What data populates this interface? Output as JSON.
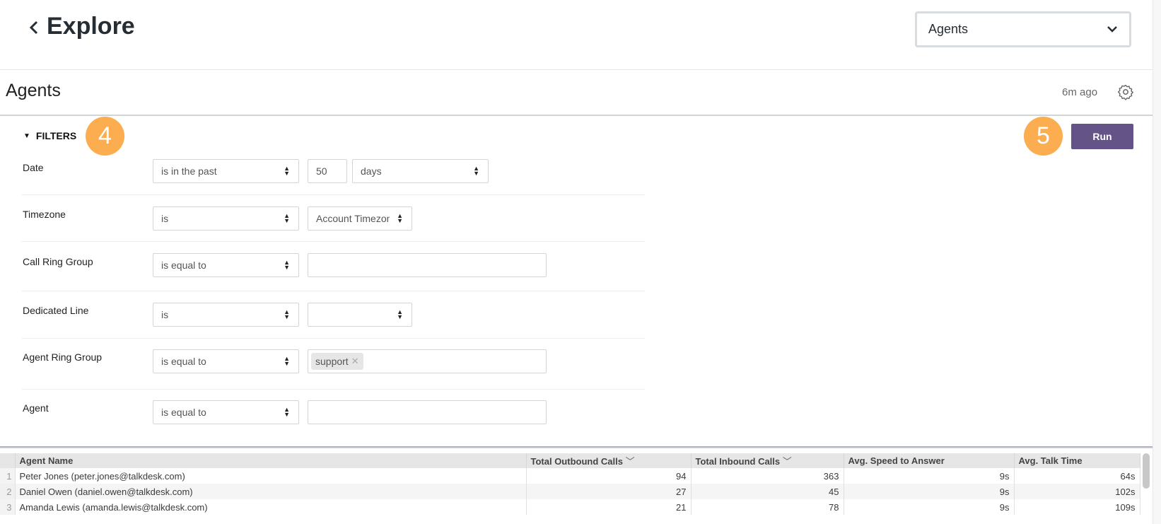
{
  "header": {
    "title": "Explore",
    "back_icon": "chevron-left-icon",
    "explore_select": "Agents"
  },
  "title_bar": {
    "title": "Agents",
    "updated": "6m ago",
    "settings_icon": "gear-icon"
  },
  "filters": {
    "toggle_label": "FILTERS",
    "run_label": "Run",
    "run_color": "#645386",
    "rows": [
      {
        "label": "Date",
        "operator": "is in the past",
        "value": "50",
        "unit": "days"
      },
      {
        "label": "Timezone",
        "operator": "is",
        "value": "Account Timezone"
      },
      {
        "label": "Call Ring Group",
        "operator": "is equal to",
        "value": ""
      },
      {
        "label": "Dedicated Line",
        "operator": "is",
        "value": ""
      },
      {
        "label": "Agent Ring Group",
        "operator": "is equal to",
        "chips": [
          "support"
        ]
      },
      {
        "label": "Agent",
        "operator": "is equal to",
        "value": ""
      }
    ]
  },
  "annotations": {
    "badge_filters": "4",
    "badge_run": "5",
    "badge_color": "#fbad50"
  },
  "table": {
    "columns": [
      "Agent Name",
      "Total Outbound Calls",
      "Total Inbound Calls",
      "Avg. Speed to Answer",
      "Avg. Talk Time"
    ],
    "rows": [
      {
        "n": "1",
        "name": "Peter Jones (peter.jones@talkdesk.com)",
        "outbound": "94",
        "inbound": "363",
        "speed": "9s",
        "talk": "64s"
      },
      {
        "n": "2",
        "name": "Daniel Owen (daniel.owen@talkdesk.com)",
        "outbound": "27",
        "inbound": "45",
        "speed": "9s",
        "talk": "102s"
      },
      {
        "n": "3",
        "name": "Amanda Lewis (amanda.lewis@talkdesk.com)",
        "outbound": "21",
        "inbound": "78",
        "speed": "9s",
        "talk": "109s"
      }
    ]
  }
}
